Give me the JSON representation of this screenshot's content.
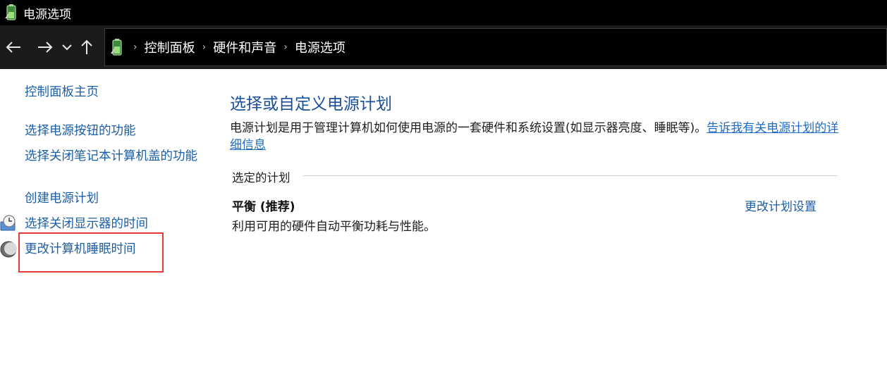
{
  "window": {
    "title": "电源选项"
  },
  "address": {
    "breadcrumbs": [
      "控制面板",
      "硬件和声音",
      "电源选项"
    ]
  },
  "left_pane": {
    "items": [
      {
        "label": "控制面板主页"
      },
      {
        "label": "选择电源按钮的功能"
      },
      {
        "label": "选择关闭笔记本计算机盖的功能"
      },
      {
        "label": "创建电源计划"
      },
      {
        "label": "选择关闭显示器的时间",
        "icon": "monitor-clock-icon"
      },
      {
        "label": "更改计算机睡眠时间",
        "icon": "moon-icon"
      }
    ]
  },
  "main": {
    "title": "选择或自定义电源计划",
    "description": "电源计划是用于管理计算机如何使用电源的一套硬件和系统设置(如显示器亮度、睡眠等)。",
    "description_link": "告诉我有关电源计划的详细信息",
    "section_label": "选定的计划",
    "plan": {
      "name": "平衡 (推荐)",
      "description": "利用可用的硬件自动平衡功耗与性能。",
      "settings_link": "更改计划设置"
    }
  },
  "colors": {
    "link": "#1c5ea8",
    "title": "#1a4f9c",
    "highlight": "#e53935"
  }
}
